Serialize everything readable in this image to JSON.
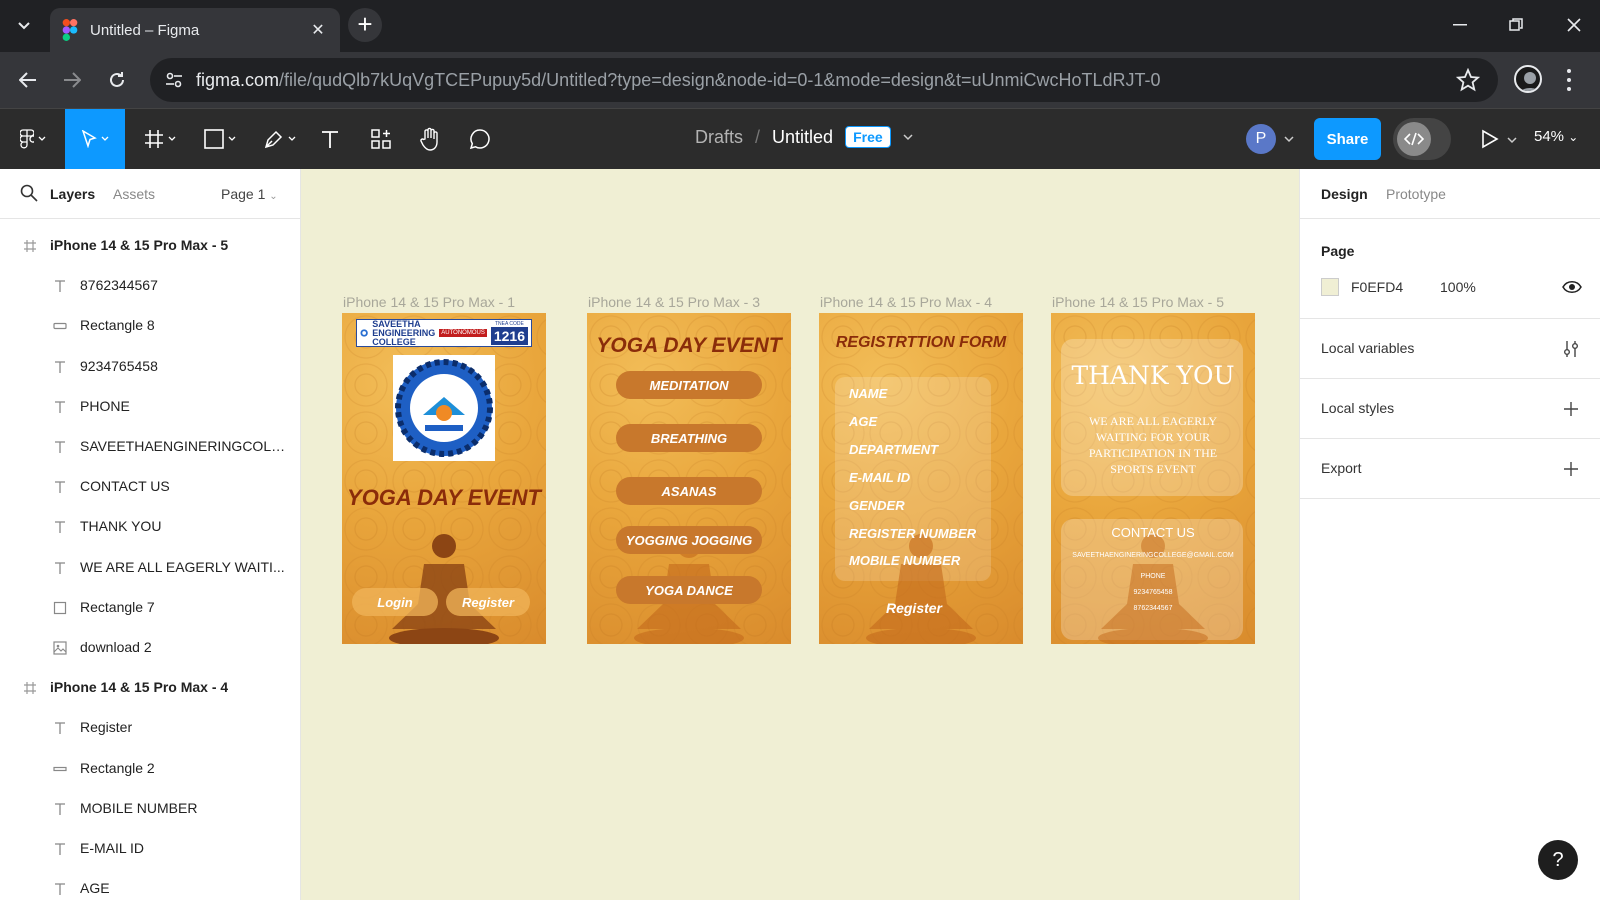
{
  "browser": {
    "tab_title": "Untitled – Figma",
    "url_host": "figma.com",
    "url_path": "/file/qudQlb7kUqVgTCEPupuy5d/Untitled?type=design&node-id=0-1&mode=design&t=uUnmiCwcHoTLdRJT-0"
  },
  "toolbar": {
    "breadcrumb_drafts": "Drafts",
    "breadcrumb_sep": "/",
    "file_title": "Untitled",
    "plan_badge": "Free",
    "avatar_initial": "P",
    "share_label": "Share",
    "zoom": "54%"
  },
  "left_panel": {
    "tab_layers": "Layers",
    "tab_assets": "Assets",
    "page_selector": "Page 1",
    "layers": [
      {
        "label": "iPhone 14 & 15 Pro Max - 5",
        "type": "frame"
      },
      {
        "label": "8762344567",
        "type": "text"
      },
      {
        "label": "Rectangle 8",
        "type": "rect-thin"
      },
      {
        "label": "9234765458",
        "type": "text"
      },
      {
        "label": "PHONE",
        "type": "text"
      },
      {
        "label": "SAVEETHAENGINERINGCOLL...",
        "type": "text"
      },
      {
        "label": "CONTACT US",
        "type": "text"
      },
      {
        "label": "THANK YOU",
        "type": "text"
      },
      {
        "label": "WE ARE ALL EAGERLY WAITI...",
        "type": "text"
      },
      {
        "label": "Rectangle 7",
        "type": "rect"
      },
      {
        "label": "download 2",
        "type": "image"
      },
      {
        "label": "iPhone 14 & 15 Pro Max - 4",
        "type": "frame"
      },
      {
        "label": "Register",
        "type": "text"
      },
      {
        "label": "Rectangle 2",
        "type": "rect-line"
      },
      {
        "label": "MOBILE NUMBER",
        "type": "text"
      },
      {
        "label": "E-MAIL ID",
        "type": "text"
      },
      {
        "label": "AGE",
        "type": "text"
      }
    ]
  },
  "canvas": {
    "background": "#F0EFD4",
    "frames": {
      "f1": {
        "label": "iPhone 14 & 15 Pro Max - 1",
        "logo_name": "SAVEETHA ENGINEERING COLLEGE",
        "logo_tag": "AUTONOMOUS",
        "tnea_label": "TNEA CODE",
        "tnea_code": "1216",
        "title": "YOGA DAY EVENT",
        "login": "Login",
        "register": "Register"
      },
      "f3": {
        "label": "iPhone 14 & 15 Pro Max - 3",
        "title": "YOGA DAY EVENT",
        "items": [
          "MEDITATION",
          "BREATHING",
          "ASANAS",
          "YOGGING JOGGING",
          "YOGA DANCE"
        ]
      },
      "f4": {
        "label": "iPhone 14 & 15 Pro Max - 4",
        "title": "REGISTRTTION FORM",
        "fields": [
          "NAME",
          "AGE",
          "DEPARTMENT",
          "E-MAIL ID",
          "GENDER",
          "REGISTER NUMBER",
          "MOBILE NUMBER"
        ],
        "register": "Register"
      },
      "f5": {
        "label": "iPhone 14 & 15 Pro Max - 5",
        "thank_you": "THANK YOU",
        "message": "WE ARE ALL EAGERLY WAITING FOR YOUR PARTICIPATION IN THE SPORTS EVENT",
        "contact_us": "CONTACT US",
        "email": "SAVEETHAENGINERINGCOLLEGE@GMAIL.COM",
        "phone_label": "PHONE",
        "phone1": "9234765458",
        "phone2": "8762344567"
      }
    }
  },
  "right_panel": {
    "tab_design": "Design",
    "tab_prototype": "Prototype",
    "page_heading": "Page",
    "page_color_hex": "F0EFD4",
    "page_color_swatch": "#F0EFD4",
    "page_opacity": "100%",
    "local_variables": "Local variables",
    "local_styles": "Local styles",
    "export": "Export"
  },
  "help_label": "?"
}
